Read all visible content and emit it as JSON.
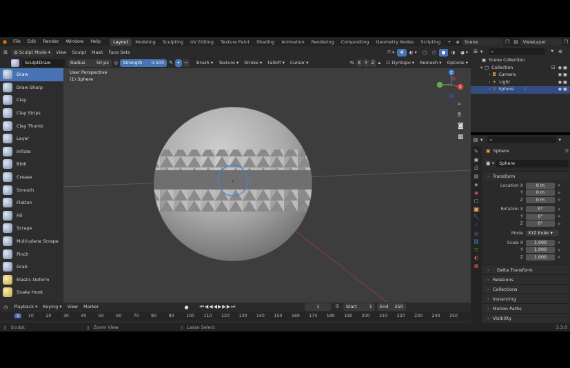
{
  "menu": [
    "File",
    "Edit",
    "Render",
    "Window",
    "Help"
  ],
  "workspaces": [
    "Layout",
    "Modeling",
    "Sculpting",
    "UV Editing",
    "Texture Paint",
    "Shading",
    "Animation",
    "Rendering",
    "Compositing",
    "Geometry Nodes",
    "Scripting"
  ],
  "active_workspace": "Layout",
  "scene": "Scene",
  "view_layer": "ViewLayer",
  "header": {
    "mode": "Sculpt Mode",
    "menus": [
      "View",
      "Sculpt",
      "Mask",
      "Face Sets"
    ],
    "brush_name": "SculptDraw",
    "radius_label": "Radius",
    "radius_value": "50 px",
    "strength_label": "Strength",
    "strength_value": "0.500",
    "dropdowns": [
      "Brush",
      "Texture",
      "Stroke",
      "Falloff",
      "Cursor"
    ],
    "axes": [
      "X",
      "Y",
      "Z"
    ],
    "dyntopo": "Dyntopo",
    "remesh": "Remesh",
    "options": "Options"
  },
  "tools": [
    "Draw",
    "Draw Sharp",
    "Clay",
    "Clay Strips",
    "Clay Thumb",
    "Layer",
    "Inflate",
    "Blob",
    "Crease",
    "Smooth",
    "Flatten",
    "Fill",
    "Scrape",
    "Multi-plane Scrape",
    "Pinch",
    "Grab",
    "Elastic Deform",
    "Snake Hook"
  ],
  "active_tool": "Draw",
  "viewport": {
    "perspective": "User Perspective",
    "object": "(1) Sphere"
  },
  "timeline": {
    "menus": [
      "Playback",
      "Keying",
      "View",
      "Marker"
    ],
    "current_frame": "1",
    "start_label": "Start",
    "start": "1",
    "end_label": "End",
    "end": "250",
    "ruler": [
      "1",
      "10",
      "20",
      "30",
      "40",
      "50",
      "60",
      "70",
      "80",
      "90",
      "100",
      "110",
      "120",
      "130",
      "140",
      "150",
      "160",
      "170",
      "180",
      "190",
      "200",
      "210",
      "220",
      "230",
      "240",
      "250"
    ]
  },
  "status": {
    "sculpt": "Sculpt",
    "zoom": "Zoom View",
    "lasso": "Lasso Select",
    "version": "3.3.0"
  },
  "outliner": {
    "items": [
      "Scene Collection",
      "Collection",
      "Camera",
      "Light",
      "Sphere"
    ],
    "selected": "Sphere"
  },
  "properties": {
    "object_name": "Sphere",
    "data_name": "Sphere",
    "transform_label": "Transform",
    "location_label": "Location X",
    "location": [
      "0 m",
      "0 m",
      "0 m"
    ],
    "rotation_label": "Rotation X",
    "rotation": [
      "0°",
      "0°",
      "0°"
    ],
    "mode_label": "Mode",
    "mode": "XYZ Euler",
    "scale_label": "Scale X",
    "scale": [
      "1.000",
      "1.000",
      "1.000"
    ],
    "y_label": "Y",
    "z_label": "Z",
    "sections": [
      "Delta Transform",
      "Relations",
      "Collections",
      "Instancing",
      "Motion Paths",
      "Visibility"
    ]
  },
  "colors": {
    "accent": "#4772b3",
    "selection": "#334d80",
    "panel": "#2a2a2a",
    "viewport": "#3d3d3d"
  }
}
